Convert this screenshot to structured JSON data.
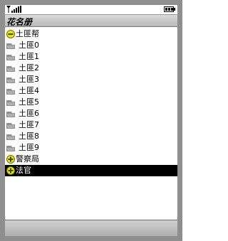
{
  "app": {
    "title": "花名册"
  },
  "tree": {
    "groups": [
      {
        "label": "土匪帮",
        "state": "expanded",
        "children": [
          "土匪0",
          "土匪1",
          "土匪2",
          "土匪3",
          "土匪4",
          "土匪5",
          "土匪6",
          "土匪7",
          "土匪8",
          "土匪9"
        ]
      },
      {
        "label": "警察局",
        "state": "collapsed",
        "children": []
      },
      {
        "label": "法官",
        "state": "collapsed",
        "selected": true,
        "children": []
      }
    ]
  },
  "colors": {
    "selection": "#000000",
    "bar": "#c0c0c0",
    "folder_icon": "#909090",
    "node_icon": "#e6e600"
  },
  "icons": {
    "expanded": "minus-node-icon",
    "collapsed": "plus-node-icon",
    "child": "folder-icon",
    "signal": "signal-icon",
    "battery": "battery-icon"
  }
}
